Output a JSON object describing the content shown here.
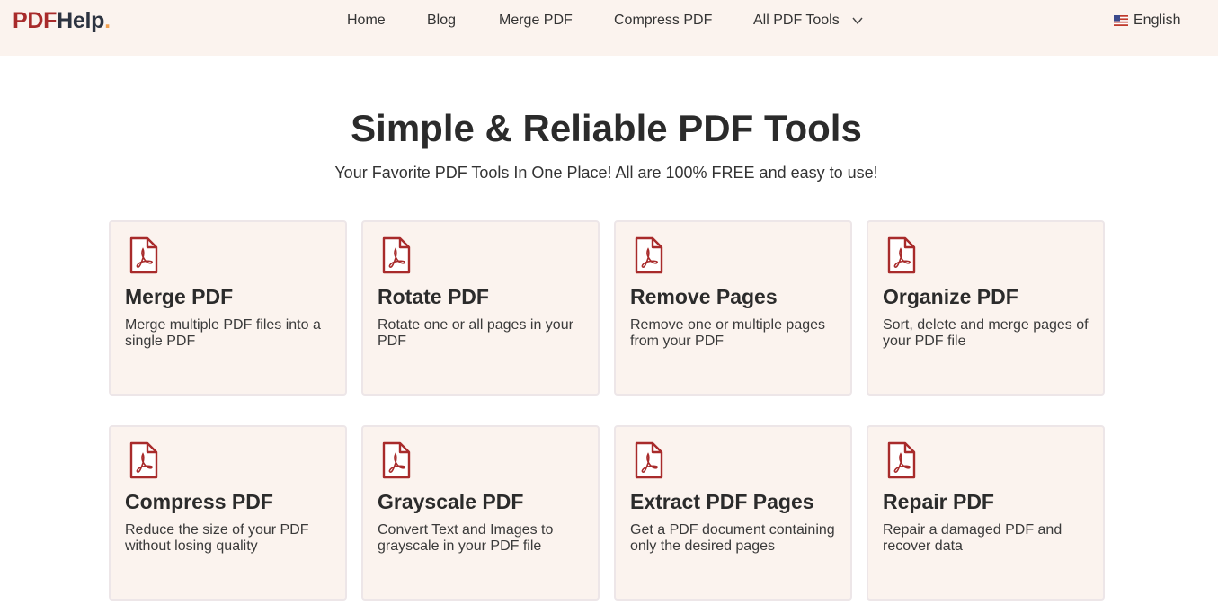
{
  "brand": {
    "part1": "PDF",
    "part2": "Help",
    "part3": "."
  },
  "nav": {
    "items": [
      {
        "label": "Home"
      },
      {
        "label": "Blog"
      },
      {
        "label": "Merge PDF"
      },
      {
        "label": "Compress PDF"
      },
      {
        "label": "All PDF Tools"
      }
    ],
    "language": "English"
  },
  "hero": {
    "title": "Simple & Reliable PDF Tools",
    "subtitle": "Your Favorite PDF Tools In One Place! All are 100% FREE and easy to use!"
  },
  "tools": [
    {
      "title": "Merge PDF",
      "desc": "Merge multiple PDF files into a single PDF",
      "icon": "pdf-file-icon"
    },
    {
      "title": "Rotate PDF",
      "desc": "Rotate one or all pages in your PDF",
      "icon": "pdf-file-icon"
    },
    {
      "title": "Remove Pages",
      "desc": "Remove one or multiple pages from your PDF",
      "icon": "pdf-file-icon"
    },
    {
      "title": "Organize PDF",
      "desc": "Sort, delete and merge pages of your PDF file",
      "icon": "pdf-file-icon"
    },
    {
      "title": "Compress PDF",
      "desc": "Reduce the size of your PDF without losing quality",
      "icon": "pdf-file-icon"
    },
    {
      "title": "Grayscale PDF",
      "desc": "Convert Text and Images to grayscale in your PDF file",
      "icon": "pdf-file-icon"
    },
    {
      "title": "Extract PDF Pages",
      "desc": "Get a PDF document containing only the desired pages",
      "icon": "pdf-file-icon"
    },
    {
      "title": "Repair PDF",
      "desc": "Repair a damaged PDF and recover data",
      "icon": "pdf-file-icon"
    }
  ],
  "colors": {
    "accent": "#a82b2b",
    "header_bg": "#fbf3ee",
    "card_bg": "#fbf3ee"
  }
}
